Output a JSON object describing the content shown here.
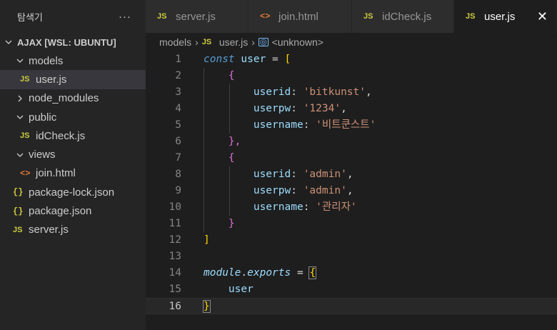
{
  "sidebar": {
    "title": "탐색기",
    "more": "···",
    "section": "AJAX [WSL: UBUNTU]",
    "items": [
      {
        "label": "models",
        "kind": "folder-open",
        "indent": 1
      },
      {
        "label": "user.js",
        "kind": "js",
        "indent": 2,
        "selected": true
      },
      {
        "label": "node_modules",
        "kind": "folder-closed",
        "indent": 1
      },
      {
        "label": "public",
        "kind": "folder-open",
        "indent": 1
      },
      {
        "label": "idCheck.js",
        "kind": "js",
        "indent": 2
      },
      {
        "label": "views",
        "kind": "folder-open",
        "indent": 1
      },
      {
        "label": "join.html",
        "kind": "html",
        "indent": 2
      },
      {
        "label": "package-lock.json",
        "kind": "json",
        "indent": 1
      },
      {
        "label": "package.json",
        "kind": "json",
        "indent": 1
      },
      {
        "label": "server.js",
        "kind": "js",
        "indent": 1
      }
    ]
  },
  "tabs": [
    {
      "label": "server.js",
      "kind": "js",
      "active": false
    },
    {
      "label": "join.html",
      "kind": "html",
      "active": false
    },
    {
      "label": "idCheck.js",
      "kind": "js",
      "active": false
    },
    {
      "label": "user.js",
      "kind": "js",
      "active": true
    }
  ],
  "icons": {
    "js": "JS",
    "json": "{}",
    "html": "<>",
    "close": "✕"
  },
  "breadcrumb": {
    "folder": "models",
    "file": "user.js",
    "symbol": "<unknown>"
  },
  "editor": {
    "current_line": 16,
    "line_numbers": [
      "1",
      "2",
      "3",
      "4",
      "5",
      "6",
      "7",
      "8",
      "9",
      "10",
      "11",
      "12",
      "13",
      "14",
      "15",
      "16"
    ],
    "code": {
      "l1": {
        "kw": "const",
        "name": "user",
        "eq": "=",
        "open": "["
      },
      "l2": {
        "open": "{"
      },
      "l3": {
        "key": "userid",
        "val": "'bitkunst'"
      },
      "l4": {
        "key": "userpw",
        "val": "'1234'"
      },
      "l5": {
        "key": "username",
        "val": "'비트쿤스트'"
      },
      "l6": {
        "close": "},"
      },
      "l7": {
        "open": "{"
      },
      "l8": {
        "key": "userid",
        "val": "'admin'"
      },
      "l9": {
        "key": "userpw",
        "val": "'admin'"
      },
      "l10": {
        "key": "username",
        "val": "'관리자'"
      },
      "l11": {
        "close": "}"
      },
      "l12": {
        "close": "]"
      },
      "l14": {
        "obj": "module",
        "dot": ".",
        "prop": "exports",
        "eq": "=",
        "open": "{"
      },
      "l15": {
        "ident": "user"
      },
      "l16": {
        "close": "}"
      }
    }
  }
}
